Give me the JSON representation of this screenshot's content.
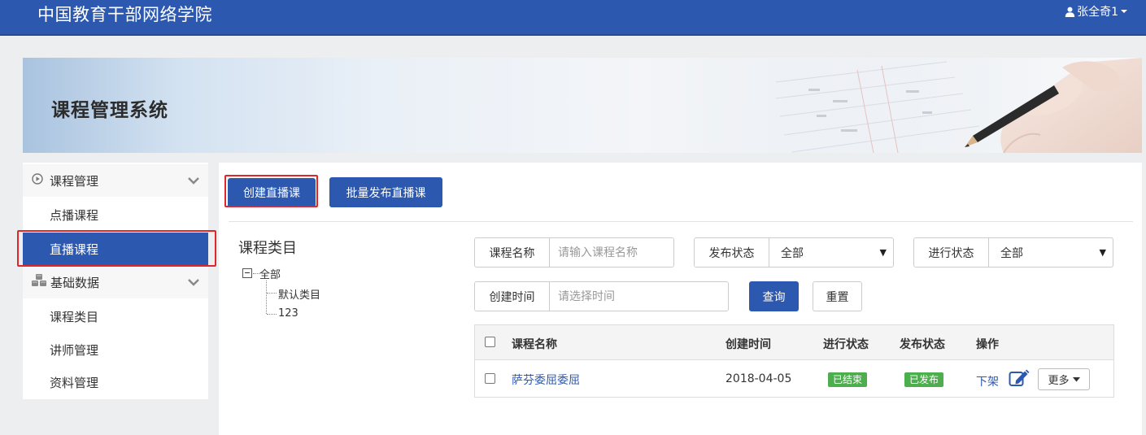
{
  "header": {
    "site_title": "中国教育干部网络学院",
    "user_name": "张全奇1",
    "brand_color": "#2d58b0"
  },
  "banner": {
    "title": "课程管理系统"
  },
  "sidebar": {
    "groups": [
      {
        "label": "课程管理",
        "icon": "play-circle-icon",
        "items": [
          {
            "label": "点播课程"
          },
          {
            "label": "直播课程",
            "active": true
          }
        ]
      },
      {
        "label": "基础数据",
        "icon": "cubes-icon",
        "items": [
          {
            "label": "课程类目"
          },
          {
            "label": "讲师管理"
          },
          {
            "label": "资料管理"
          }
        ]
      }
    ]
  },
  "toolbar": {
    "create_label": "创建直播课",
    "batch_publish_label": "批量发布直播课"
  },
  "category_tree": {
    "title": "课程类目",
    "root": "全部",
    "children": [
      "默认类目",
      "123"
    ]
  },
  "filters": {
    "course_name": {
      "label": "课程名称",
      "placeholder": "请输入课程名称"
    },
    "publish_status": {
      "label": "发布状态",
      "value": "全部"
    },
    "progress_status": {
      "label": "进行状态",
      "value": "全部"
    },
    "created_time": {
      "label": "创建时间",
      "placeholder": "请选择时间"
    },
    "query_label": "查询",
    "reset_label": "重置"
  },
  "table": {
    "headers": {
      "name": "课程名称",
      "created": "创建时间",
      "progress": "进行状态",
      "publish": "发布状态",
      "actions": "操作"
    },
    "rows": [
      {
        "name": "萨芬委屈委屈",
        "created": "2018-04-05",
        "progress": "已结束",
        "publish": "已发布",
        "action_link": "下架",
        "more_label": "更多"
      }
    ]
  },
  "colors": {
    "status_tag": "#4cae4c",
    "highlight": "#e0262b"
  }
}
